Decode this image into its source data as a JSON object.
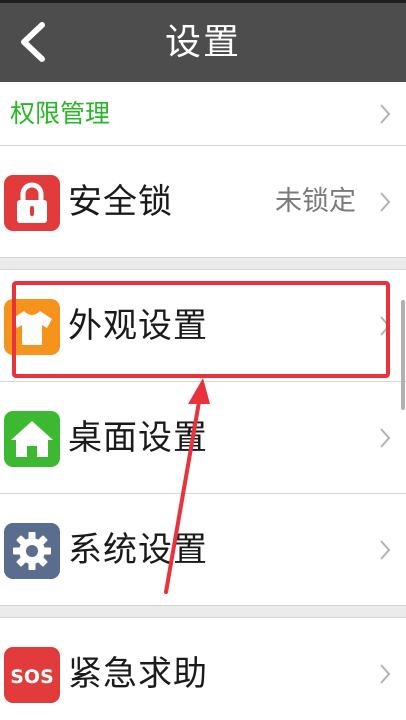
{
  "header": {
    "title": "设置",
    "back_icon": "back-arrow-icon"
  },
  "permission": {
    "label": "权限管理",
    "color": "#26b826"
  },
  "items": [
    {
      "label": "安全锁",
      "value": "未锁定",
      "icon": "lock-icon",
      "icon_color": "#e23b3b"
    },
    {
      "label": "外观设置",
      "value": "",
      "icon": "tshirt-icon",
      "icon_color": "#f5931d"
    },
    {
      "label": "桌面设置",
      "value": "",
      "icon": "home-icon",
      "icon_color": "#3cb831"
    },
    {
      "label": "系统设置",
      "value": "",
      "icon": "gear-icon",
      "icon_color": "#5a6d8e"
    },
    {
      "label": "紧急求助",
      "value": "",
      "icon": "sos-icon",
      "icon_color": "#e23b3b",
      "icon_text": "SOS"
    }
  ],
  "annotation": {
    "color": "#e8323c",
    "highlighted_item": "外观设置"
  }
}
